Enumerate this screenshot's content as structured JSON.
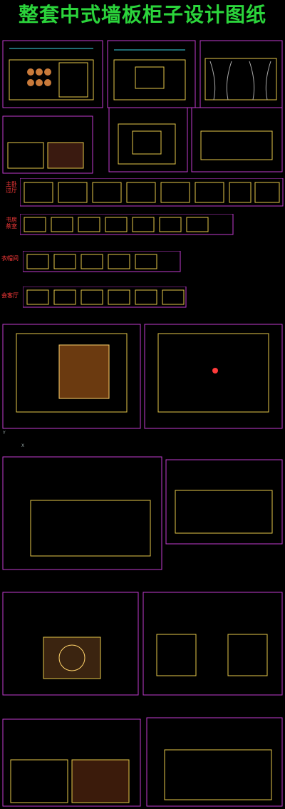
{
  "title": "整套中式墙板柜子设计图纸",
  "sections": {
    "s1": "主卧",
    "s1b": "过厅",
    "s2": "书房",
    "s2b": "茶室",
    "s3": "衣帽间",
    "s4": "会客厅"
  },
  "axis": {
    "x": "X",
    "y": "Y"
  },
  "colors": {
    "title": "#2bd43b",
    "frame": "#c23bd1",
    "line": "#e6c84a",
    "accent": "#ff3b3b",
    "cyan": "#3bd6e6"
  }
}
